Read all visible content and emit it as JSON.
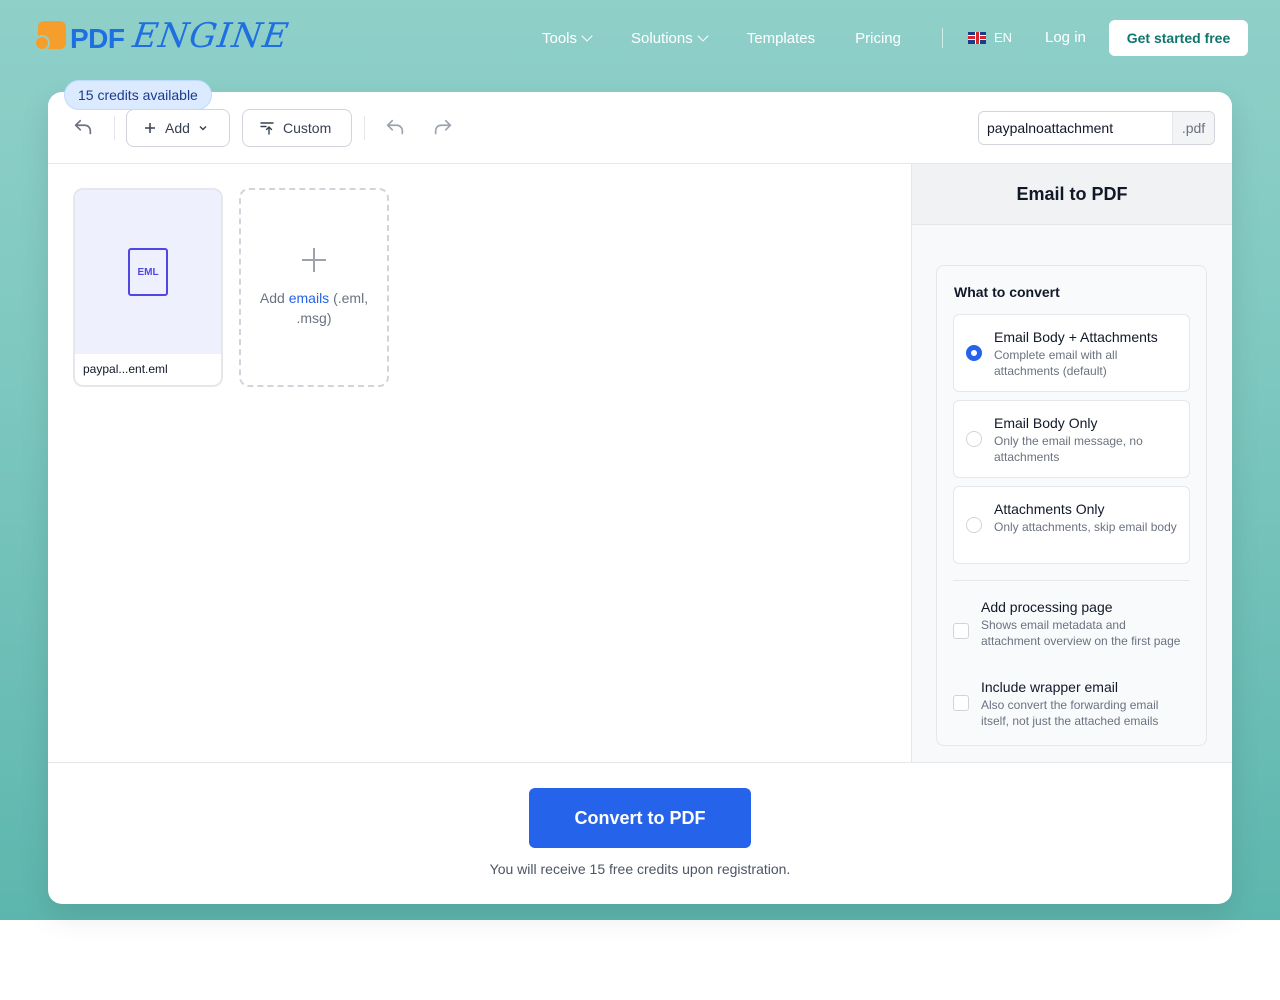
{
  "brand": {
    "name_pdf": "PDF",
    "name_engine": "ENGINE"
  },
  "nav": {
    "items": [
      {
        "label": "Tools",
        "has_dropdown": true
      },
      {
        "label": "Solutions",
        "has_dropdown": true
      },
      {
        "label": "Templates",
        "has_dropdown": false
      },
      {
        "label": "Pricing",
        "has_dropdown": false
      }
    ],
    "language": "EN",
    "login": "Log in",
    "cta": "Get started free"
  },
  "credits": {
    "badge": "15 credits available"
  },
  "toolbar": {
    "add_label": "Add",
    "custom_label": "Custom",
    "filename": "paypalnoattachment",
    "extension": ".pdf"
  },
  "files": [
    {
      "type_label": "EML",
      "name": "paypal...ent.eml"
    }
  ],
  "add_card": {
    "prefix": "Add",
    "link": "emails",
    "suffix_1": "(.eml,",
    "suffix_2": ".msg)"
  },
  "panel": {
    "title": "Email to PDF",
    "section_title": "What to convert",
    "options": [
      {
        "label": "Email Body + Attachments",
        "desc": "Complete email with all attachments (default)",
        "selected": true
      },
      {
        "label": "Email Body Only",
        "desc": "Only the email message, no attachments",
        "selected": false
      },
      {
        "label": "Attachments Only",
        "desc": "Only attachments, skip email body",
        "selected": false
      }
    ],
    "checks": [
      {
        "label": "Add processing page",
        "desc": "Shows email metadata and attachment overview on the first page",
        "checked": false
      },
      {
        "label": "Include wrapper email",
        "desc": "Also convert the forwarding email itself, not just the attached emails",
        "checked": false
      }
    ]
  },
  "convert": {
    "button": "Convert to PDF",
    "note": "You will receive 15 free credits upon registration."
  },
  "colors": {
    "primary": "#2563eb",
    "accent": "#f59e2c",
    "background": "#7ec8c0"
  }
}
